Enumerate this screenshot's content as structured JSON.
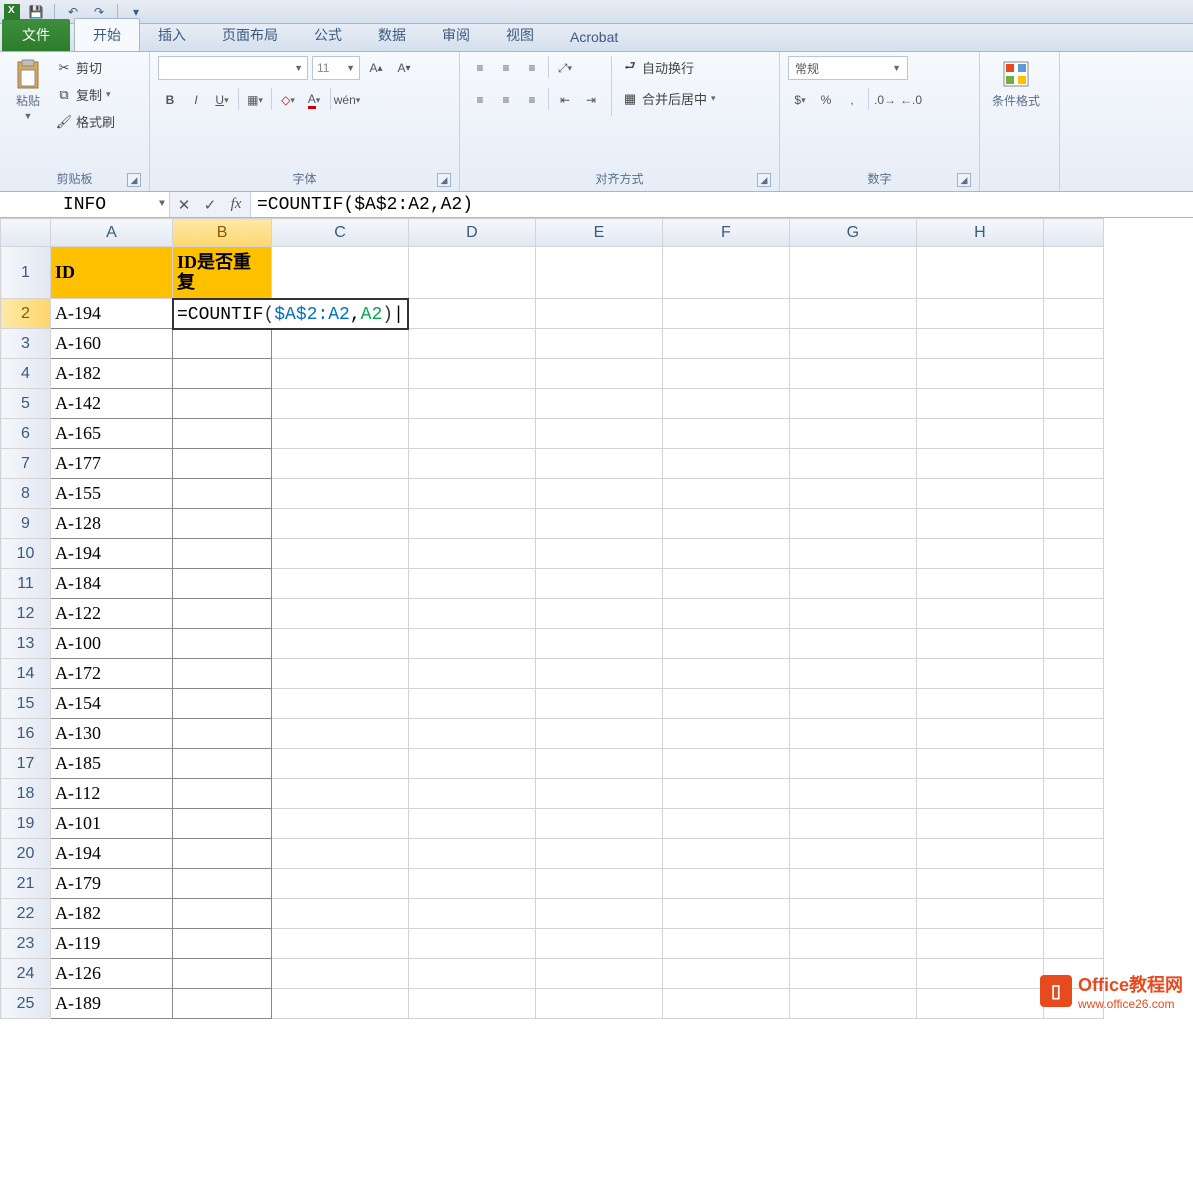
{
  "qat": {
    "save": "💾",
    "undo": "↶",
    "redo": "↷"
  },
  "tabs": {
    "file": "文件",
    "home": "开始",
    "insert": "插入",
    "layout": "页面布局",
    "formulas": "公式",
    "data": "数据",
    "review": "审阅",
    "view": "视图",
    "acrobat": "Acrobat"
  },
  "ribbon": {
    "clipboard": {
      "label": "剪贴板",
      "paste": "粘贴",
      "cut": "剪切",
      "copy": "复制",
      "format_painter": "格式刷"
    },
    "font": {
      "label": "字体",
      "size": "11"
    },
    "alignment": {
      "label": "对齐方式",
      "wrap": "自动换行",
      "merge": "合并后居中"
    },
    "number": {
      "label": "数字",
      "format": "常规"
    },
    "styles": {
      "cond_format": "条件格式"
    }
  },
  "formula_bar": {
    "name_box": "INFO",
    "cancel": "✕",
    "enter": "✓",
    "fx": "fx",
    "formula": "=COUNTIF($A$2:A2,A2)"
  },
  "columns": [
    "A",
    "B",
    "C",
    "D",
    "E",
    "F",
    "G",
    "H"
  ],
  "header_row": {
    "A": "ID",
    "B": "ID是否重复"
  },
  "editing_cell_display": "=COUNTIF($A$2:A2,A2)",
  "rows": [
    {
      "n": 1,
      "A": "ID",
      "B": "ID是否重复"
    },
    {
      "n": 2,
      "A": "A-194",
      "B": "=COUNTIF($A$2:A2,A2)"
    },
    {
      "n": 3,
      "A": "A-160",
      "B": ""
    },
    {
      "n": 4,
      "A": "A-182",
      "B": ""
    },
    {
      "n": 5,
      "A": "A-142",
      "B": ""
    },
    {
      "n": 6,
      "A": "A-165",
      "B": ""
    },
    {
      "n": 7,
      "A": "A-177",
      "B": ""
    },
    {
      "n": 8,
      "A": "A-155",
      "B": ""
    },
    {
      "n": 9,
      "A": "A-128",
      "B": ""
    },
    {
      "n": 10,
      "A": "A-194",
      "B": ""
    },
    {
      "n": 11,
      "A": "A-184",
      "B": ""
    },
    {
      "n": 12,
      "A": "A-122",
      "B": ""
    },
    {
      "n": 13,
      "A": "A-100",
      "B": ""
    },
    {
      "n": 14,
      "A": "A-172",
      "B": ""
    },
    {
      "n": 15,
      "A": "A-154",
      "B": ""
    },
    {
      "n": 16,
      "A": "A-130",
      "B": ""
    },
    {
      "n": 17,
      "A": "A-185",
      "B": ""
    },
    {
      "n": 18,
      "A": "A-112",
      "B": ""
    },
    {
      "n": 19,
      "A": "A-101",
      "B": ""
    },
    {
      "n": 20,
      "A": "A-194",
      "B": ""
    },
    {
      "n": 21,
      "A": "A-179",
      "B": ""
    },
    {
      "n": 22,
      "A": "A-182",
      "B": ""
    },
    {
      "n": 23,
      "A": "A-119",
      "B": ""
    },
    {
      "n": 24,
      "A": "A-126",
      "B": ""
    },
    {
      "n": 25,
      "A": "A-189",
      "B": ""
    }
  ],
  "watermark": {
    "brand": "Office教程网",
    "url": "www.office26.com"
  }
}
